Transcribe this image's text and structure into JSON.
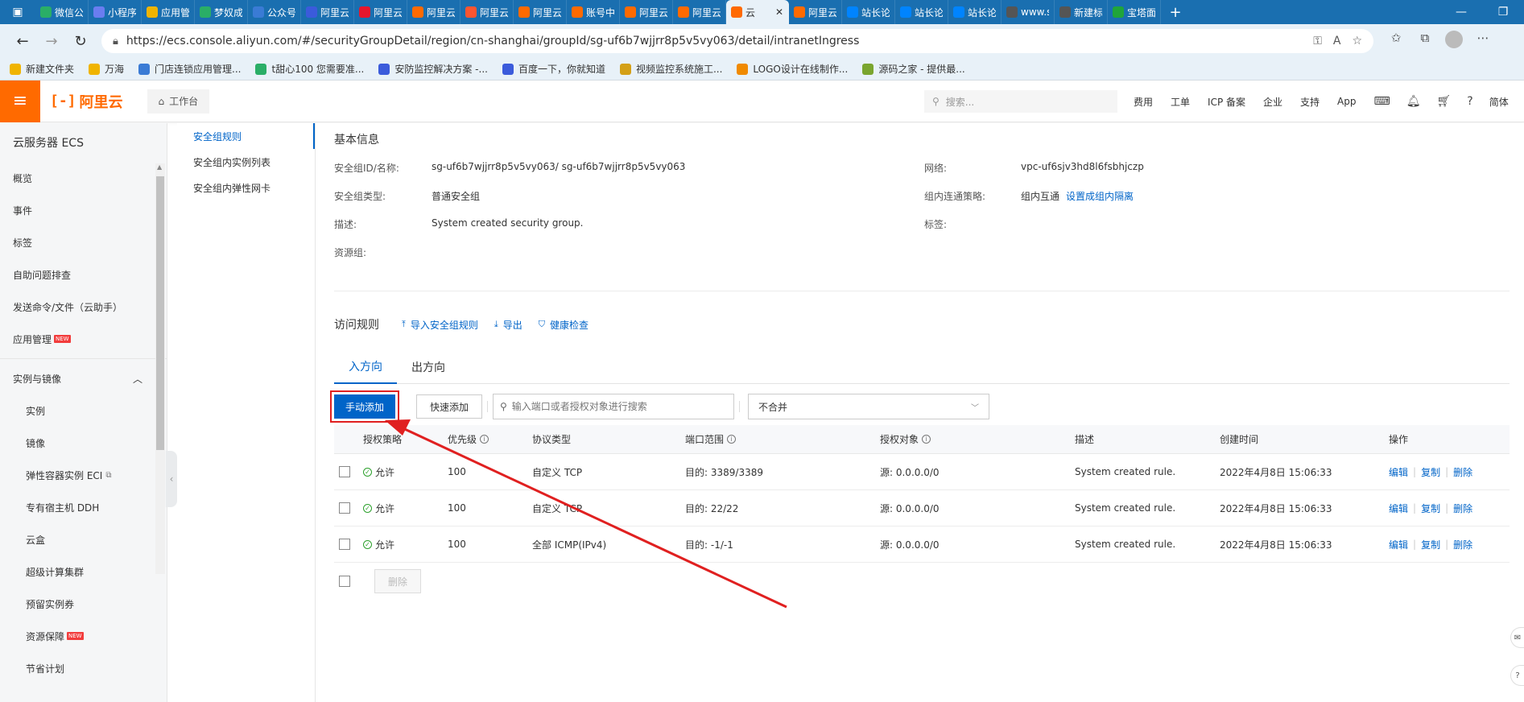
{
  "browser": {
    "tabs": [
      {
        "label": "微信公",
        "icon": "wechat-official-icon",
        "color": "#2aae67"
      },
      {
        "label": "小程序",
        "icon": "mini-program-icon",
        "color": "#6a7df0"
      },
      {
        "label": "应用管",
        "icon": "app-manage-icon",
        "color": "#f0b400"
      },
      {
        "label": "梦奴成",
        "icon": "wechat-icon",
        "color": "#2aae67"
      },
      {
        "label": "公众号",
        "icon": "document-icon",
        "color": "#3a7bd5"
      },
      {
        "label": "阿里云",
        "icon": "paw-icon",
        "color": "#3b5bdb"
      },
      {
        "label": "阿里云",
        "icon": "weibo-icon",
        "color": "#e6162d"
      },
      {
        "label": "阿里云",
        "icon": "aliyun-icon",
        "color": "#ff6a00"
      },
      {
        "label": "阿里云",
        "icon": "csdn-icon",
        "color": "#fc5531"
      },
      {
        "label": "阿里云",
        "icon": "aliyun-icon",
        "color": "#ff6a00"
      },
      {
        "label": "账号中",
        "icon": "aliyun-icon",
        "color": "#ff6a00"
      },
      {
        "label": "阿里云",
        "icon": "aliyun-icon",
        "color": "#ff6a00"
      },
      {
        "label": "阿里云",
        "icon": "aliyun-icon",
        "color": "#ff6a00"
      },
      {
        "label": "云",
        "icon": "aliyun-icon",
        "color": "#ff6a00",
        "active": true
      },
      {
        "label": "阿里云",
        "icon": "aliyun-icon",
        "color": "#ff6a00"
      },
      {
        "label": "站长论",
        "icon": "zhihu-icon",
        "color": "#0084ff"
      },
      {
        "label": "站长论",
        "icon": "zhihu-icon",
        "color": "#0084ff"
      },
      {
        "label": "站长论",
        "icon": "zhihu-icon",
        "color": "#0084ff"
      },
      {
        "label": "www.sh",
        "icon": "link-icon",
        "color": "#555555"
      },
      {
        "label": "新建标",
        "icon": "new-tab-icon",
        "color": "#555555"
      },
      {
        "label": "宝塔面",
        "icon": "baota-icon",
        "color": "#20a53a"
      }
    ],
    "url": "https://ecs.console.aliyun.com/#/securityGroupDetail/region/cn-shanghai/groupId/sg-uf6b7wjjrr8p5v5vy063/detail/intranetIngress",
    "bookmarks": [
      {
        "label": "新建文件夹",
        "icon": "folder-icon",
        "color": "#f0b400"
      },
      {
        "label": "万海",
        "icon": "folder-icon",
        "color": "#f0b400"
      },
      {
        "label": "门店连锁应用管理...",
        "icon": "grid-icon",
        "color": "#3a7bd5"
      },
      {
        "label": "t甜心100 您需要准...",
        "icon": "cloud-icon",
        "color": "#2aae67"
      },
      {
        "label": "安防监控解决方案 -...",
        "icon": "paw-icon",
        "color": "#3b5bdb"
      },
      {
        "label": "百度一下，你就知道",
        "icon": "paw-icon",
        "color": "#3b5bdb"
      },
      {
        "label": "视频监控系统施工...",
        "icon": "s-icon",
        "color": "#d4a017"
      },
      {
        "label": "LOGO设计在线制作...",
        "icon": "c-icon",
        "color": "#f08a00"
      },
      {
        "label": "源码之家 - 提供最...",
        "icon": "m-icon",
        "color": "#7aa52e"
      }
    ]
  },
  "console": {
    "brand": "阿里云",
    "workbench": "工作台",
    "search_placeholder": "搜索...",
    "menu": [
      "费用",
      "工单",
      "ICP 备案",
      "企业",
      "支持",
      "App"
    ],
    "lang": "简体"
  },
  "sidebar": {
    "title": "云服务器 ECS",
    "items": [
      "概览",
      "事件",
      "标签",
      "自助问题排查",
      "发送命令/文件（云助手）",
      "应用管理"
    ],
    "new_badge": "NEW",
    "group": "实例与镜像",
    "sub_items": [
      "实例",
      "镜像",
      "弹性容器实例 ECI",
      "专有宿主机 DDH",
      "云盒",
      "超级计算集群",
      "预留实例券",
      "资源保障",
      "节省计划"
    ]
  },
  "subnav": {
    "items": [
      "安全组规则",
      "安全组内实例列表",
      "安全组内弹性网卡"
    ]
  },
  "basic_info": {
    "title": "基本信息",
    "id_label": "安全组ID/名称:",
    "id_value": "sg-uf6b7wjjrr8p5v5vy063/ sg-uf6b7wjjrr8p5v5vy063",
    "type_label": "安全组类型:",
    "type_value": "普通安全组",
    "desc_label": "描述:",
    "desc_value": "System created security group.",
    "rg_label": "资源组:",
    "vpc_label": "网络:",
    "vpc_value": "vpc-uf6sjv3hd8l6fsbhjczp",
    "policy_label": "组内连通策略:",
    "policy_value": "组内互通",
    "policy_link": "设置成组内隔离",
    "tag_label": "标签:"
  },
  "rules": {
    "title": "访问规则",
    "import": "导入安全组规则",
    "export": "导出",
    "health": "健康检查",
    "tabs": [
      "入方向",
      "出方向"
    ],
    "add_manual": "手动添加",
    "add_quick": "快速添加",
    "search_placeholder": "输入端口或者授权对象进行搜索",
    "merge_select": "不合并",
    "columns": [
      "授权策略",
      "优先级",
      "协议类型",
      "端口范围",
      "授权对象",
      "描述",
      "创建时间",
      "操作"
    ],
    "rows": [
      {
        "policy": "允许",
        "priority": "100",
        "protocol": "自定义 TCP",
        "port": "目的: 3389/3389",
        "source": "源: 0.0.0.0/0",
        "desc": "System created rule.",
        "time": "2022年4月8日 15:06:33"
      },
      {
        "policy": "允许",
        "priority": "100",
        "protocol": "自定义 TCP",
        "port": "目的: 22/22",
        "source": "源: 0.0.0.0/0",
        "desc": "System created rule.",
        "time": "2022年4月8日 15:06:33"
      },
      {
        "policy": "允许",
        "priority": "100",
        "protocol": "全部 ICMP(IPv4)",
        "port": "目的: -1/-1",
        "source": "源: 0.0.0.0/0",
        "desc": "System created rule.",
        "time": "2022年4月8日 15:06:33"
      }
    ],
    "ops": [
      "编辑",
      "复制",
      "删除"
    ],
    "delete_btn": "删除"
  },
  "colors": {
    "accent": "#0064c8",
    "brand": "#ff6a00",
    "annotation": "#e02020"
  }
}
